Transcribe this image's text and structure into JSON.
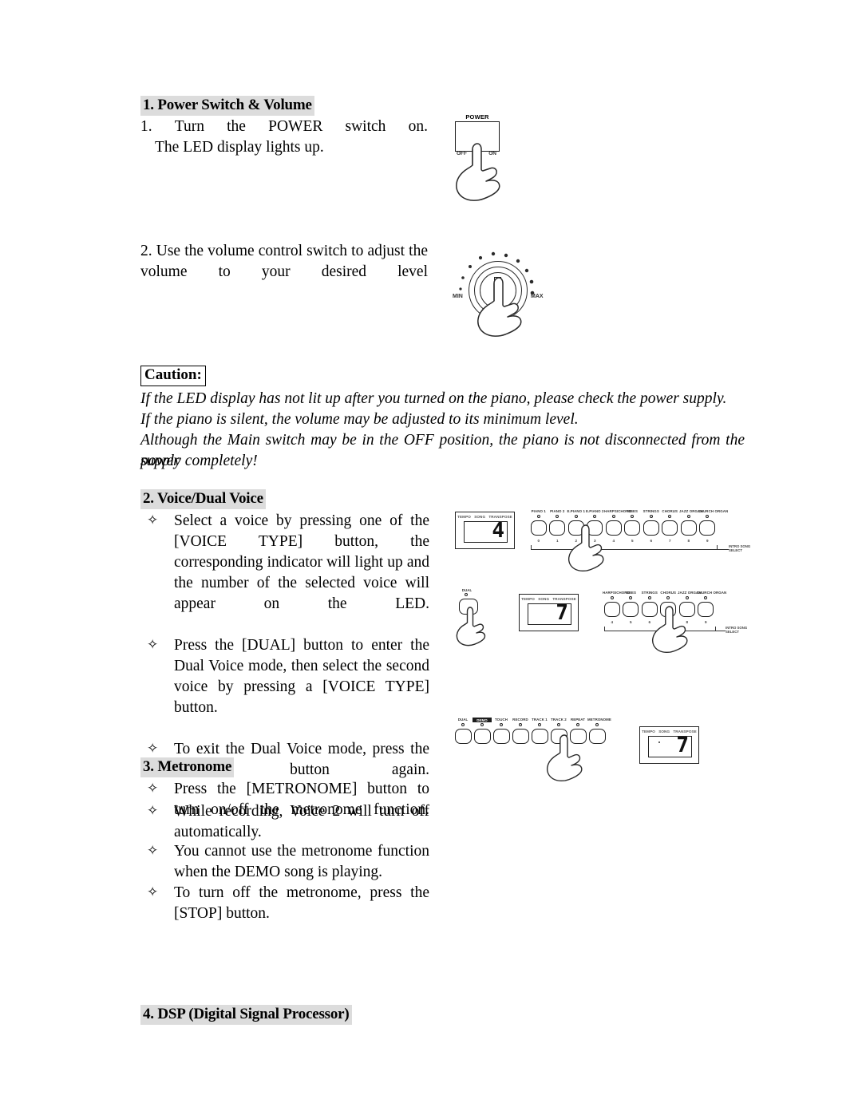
{
  "document": {
    "type": "digital-piano-owners-manual-page",
    "page_background": "#ffffff",
    "heading_highlight_color": "#dcdcdc",
    "text_color": "#000000"
  },
  "sections": [
    {
      "id": "power-switch-volume",
      "heading": "1. Power Switch & Volume",
      "steps": [
        {
          "number": "1.",
          "justified_words": [
            "1.",
            "Turn",
            "the",
            "POWER",
            "switch",
            "on."
          ],
          "line2": "The LED display lights up."
        },
        {
          "number": "2.",
          "text": "2. Use the volume control switch to adjust the volume to your desired level"
        }
      ]
    },
    {
      "id": "caution",
      "label": "Caution:",
      "lines": [
        "If the LED display has not lit up after you turned on the piano, please check the power supply.",
        "If the piano is silent, the volume may be adjusted to its minimum level.",
        "Although the Main switch may be in the OFF position, the piano is not disconnected from the power",
        "supply completely!"
      ]
    },
    {
      "id": "voice-dual-voice",
      "heading": "2. Voice/Dual Voice",
      "bullet_glyph": "✧",
      "bullets": [
        "Select a voice by pressing one of the [VOICE TYPE] button, the corresponding indicator will light up and the number of the selected voice will appear on the LED.",
        "Press the [DUAL] button to enter the Dual Voice mode, then select the second voice by pressing a [VOICE TYPE] button.",
        "To exit the Dual Voice mode, press the [DUAL] button again.",
        "While recording, Voice 2 will turn off automatically."
      ]
    },
    {
      "id": "metronome",
      "heading": "3. Metronome",
      "bullet_glyph": "✧",
      "bullets": [
        "Press the [METRONOME] button to turn on/off the metronome function.",
        "You cannot use the metronome function when the DEMO song is playing.",
        "To turn off the metronome, press the [STOP] button."
      ]
    },
    {
      "id": "dsp",
      "heading": "4. DSP (Digital Signal Processor)"
    }
  ],
  "diagrams": {
    "power_switch": {
      "title": "POWER",
      "off_label": "OFF",
      "on_label": "ON"
    },
    "volume_knob": {
      "min_label": "MIN",
      "max_label": "MAX"
    },
    "led_display_1": {
      "tags": [
        "TEMPO",
        "SONG",
        "TRANSPOSE"
      ],
      "value": "4"
    },
    "led_display_2": {
      "tags": [
        "TEMPO",
        "SONG",
        "TRANSPOSE"
      ],
      "value": "7"
    },
    "led_display_3": {
      "tags": [
        "TEMPO",
        "SONG",
        "TRANSPOSE"
      ],
      "value": "7"
    },
    "voice_button_row_full": {
      "annotation": [
        "INTRO SONG",
        "SELECT"
      ],
      "pressed_index": 4,
      "buttons": [
        {
          "name": "PIANO 1",
          "number": "0"
        },
        {
          "name": "PIANO 2",
          "number": "1"
        },
        {
          "name": "E.PIANO 1",
          "number": "2"
        },
        {
          "name": "E.PIANO 2",
          "number": "3"
        },
        {
          "name": "HARPSICHORD",
          "number": "4"
        },
        {
          "name": "VIBES",
          "number": "5"
        },
        {
          "name": "STRINGS",
          "number": "6"
        },
        {
          "name": "CHORUS",
          "number": "7"
        },
        {
          "name": "JAZZ ORGAN",
          "number": "8"
        },
        {
          "name": "CHURCH ORGAN",
          "number": "9"
        }
      ]
    },
    "voice_button_row_partial": {
      "annotation": [
        "INTRO SONG",
        "SELECT"
      ],
      "pressed_index": 3,
      "buttons": [
        {
          "name": "HARPSICHORD",
          "number": "4"
        },
        {
          "name": "VIBES",
          "number": "5"
        },
        {
          "name": "STRINGS",
          "number": "6"
        },
        {
          "name": "CHORUS",
          "number": "7"
        },
        {
          "name": "JAZZ ORGAN",
          "number": "8"
        },
        {
          "name": "CHURCH ORGAN",
          "number": "9"
        }
      ]
    },
    "dual_button": {
      "name": "DUAL"
    },
    "function_button_row": {
      "pressed_index": 7,
      "buttons": [
        {
          "name": "DUAL",
          "inverted": false
        },
        {
          "name": "DEMO",
          "inverted": true
        },
        {
          "name": "TOUCH",
          "inverted": false
        },
        {
          "name": "RECORD",
          "inverted": false
        },
        {
          "name": "TRACK 1",
          "inverted": false
        },
        {
          "name": "TRACK 2",
          "inverted": false
        },
        {
          "name": "REPEAT",
          "inverted": false
        },
        {
          "name": "METRONOME",
          "inverted": false
        }
      ]
    }
  }
}
